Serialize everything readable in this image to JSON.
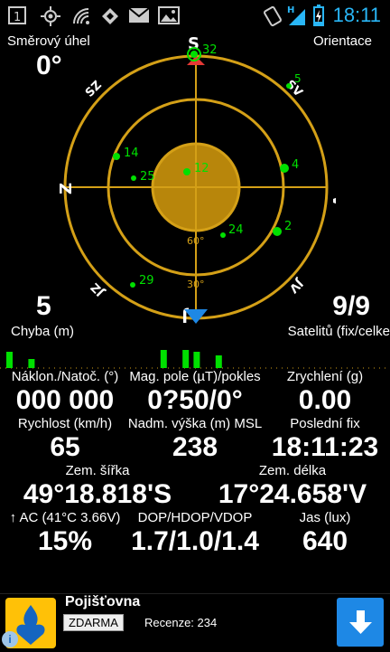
{
  "statusbar": {
    "time": "18:11",
    "network": "H",
    "icons": [
      "sim1-icon",
      "gps-icon",
      "wifi-icon",
      "airdroid-icon",
      "gmail-icon",
      "gallery-icon",
      "vibrate-icon",
      "signal-icon",
      "battery-icon"
    ]
  },
  "compass": {
    "heading_label": "Směrový úhel",
    "heading_value": "0°",
    "orientation_label": "Orientace",
    "dir_n": "S",
    "dir_ne": "SV",
    "dir_e": "V",
    "dir_se": "JV",
    "dir_s": "J",
    "dir_sw": "JZ",
    "dir_w": "Z",
    "dir_nw": "SZ",
    "ring_60": "60°",
    "ring_30": "30°",
    "satellites": [
      {
        "id": "32",
        "color": "#00e000"
      },
      {
        "id": "14",
        "color": "#00e000"
      },
      {
        "id": "25",
        "color": "#00e000"
      },
      {
        "id": "12",
        "color": "#00e000"
      },
      {
        "id": "4",
        "color": "#00e000"
      },
      {
        "id": "24",
        "color": "#00e000"
      },
      {
        "id": "2",
        "color": "#00e000"
      },
      {
        "id": "29",
        "color": "#00e000"
      },
      {
        "id": "5",
        "color": "#00e000"
      }
    ]
  },
  "error": {
    "value": "5",
    "label": "Chyba (m)"
  },
  "sats": {
    "value": "9/9",
    "label": "Satelitů (fix/celke"
  },
  "snr_bars": [
    18,
    0,
    10,
    0,
    0,
    0,
    0,
    0,
    0,
    0,
    0,
    0,
    0,
    0,
    20,
    0,
    20,
    18,
    0,
    14
  ],
  "metrics": {
    "tilt_label": "Náklon./Natoč. (°)",
    "tilt_value": "000 000",
    "mag_label": "Mag. pole (µT)/pokles",
    "mag_value": "0?50/0°",
    "accel_label": "Zrychlení (g)",
    "accel_value": "0.00",
    "speed_label": "Rychlost (km/h)",
    "speed_value": "65",
    "alt_label": "Nadm. výška (m) MSL",
    "alt_value": "238",
    "lastfix_label": "Poslední fix",
    "lastfix_value": "18:11:23",
    "lat_label": "Zem. šířka",
    "lat_value": "49°18.818'S",
    "lon_label": "Zem. délka",
    "lon_value": "17°24.658'V",
    "battery_label": "↑ AC (41°C 3.66V)",
    "battery_value": "15%",
    "dop_label": "DOP/HDOP/VDOP",
    "dop_value": "1.7/1.0/1.4",
    "lux_label": "Jas (lux)",
    "lux_value": "640"
  },
  "ad": {
    "title": "Pojišťovna",
    "badge": "ZDARMA",
    "reviews": "Recenze: 234",
    "info": "i"
  }
}
